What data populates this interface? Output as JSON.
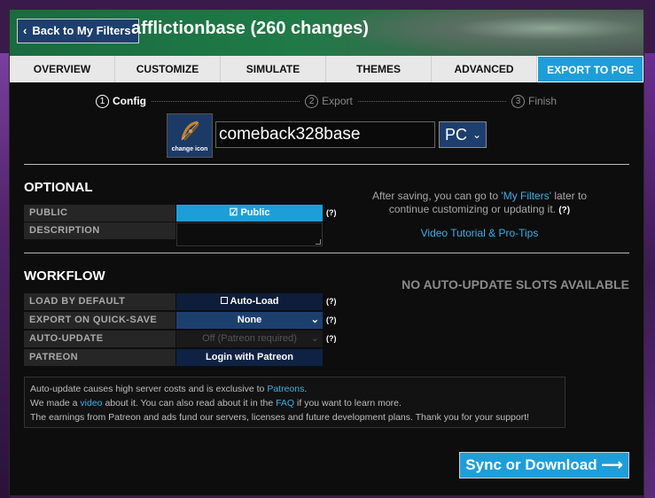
{
  "header": {
    "back_label": "Back to My Filters",
    "title": "afflictionbase (260 changes)"
  },
  "nav": {
    "tabs": [
      {
        "label": "OVERVIEW"
      },
      {
        "label": "CUSTOMIZE"
      },
      {
        "label": "SIMULATE"
      },
      {
        "label": "THEMES"
      },
      {
        "label": "ADVANCED"
      },
      {
        "label": "EXPORT TO POE"
      }
    ],
    "active_index": 5
  },
  "steps": [
    {
      "num": "1",
      "label": "Config"
    },
    {
      "num": "2",
      "label": "Export"
    },
    {
      "num": "3",
      "label": "Finish"
    }
  ],
  "filter": {
    "icon_label": "change icon",
    "name_value": "comeback328base",
    "platform": "PC"
  },
  "optional": {
    "title": "OPTIONAL",
    "public_label": "PUBLIC",
    "public_value": "Public",
    "description_label": "DESCRIPTION",
    "help": "(?)",
    "note_pre": "After saving, you can go to ",
    "note_link": "'My Filters'",
    "note_post": " later to continue customizing or updating it.",
    "tutorial_link": "Video Tutorial & Pro-Tips"
  },
  "workflow": {
    "title": "WORKFLOW",
    "slots_notice": "NO AUTO-UPDATE SLOTS AVAILABLE",
    "load_default_label": "LOAD BY DEFAULT",
    "load_default_value": "Auto-Load",
    "quicksave_label": "EXPORT ON QUICK-SAVE",
    "quicksave_value": "None",
    "autoupdate_label": "AUTO-UPDATE",
    "autoupdate_value": "Off (Patreon required)",
    "patreon_label": "PATREON",
    "patreon_button": "Login with Patreon",
    "help": "(?)"
  },
  "info": {
    "line1_pre": "Auto-update causes high server costs and is exclusive to ",
    "line1_link": "Patreons",
    "line1_post": ".",
    "line2_pre": "We made a ",
    "line2_link1": "video",
    "line2_mid": " about it. You can also read about it in the ",
    "line2_link2": "FAQ",
    "line2_post": " if you want to learn more.",
    "line3": "The earnings from Patreon and ads fund our servers, licenses and future development plans. Thank you for your support!"
  },
  "actions": {
    "sync_label": "Sync or Download ⟶"
  },
  "colors": {
    "accent": "#1e9ed8",
    "navy": "#1d3f6e",
    "banner_green": "#1f7a47"
  }
}
